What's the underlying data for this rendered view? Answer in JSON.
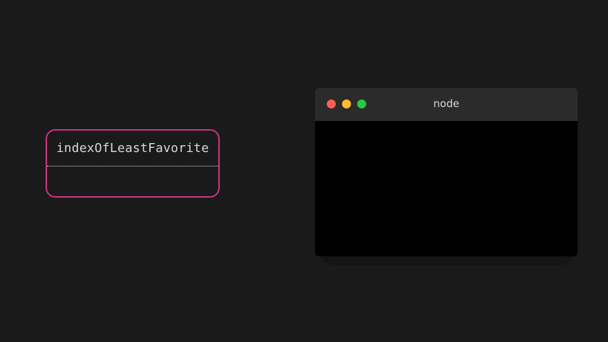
{
  "variable": {
    "name": "indexOfLeastFavorite",
    "value": ""
  },
  "terminal": {
    "title": "node",
    "output": "",
    "controls": {
      "close_color": "#ff5f57",
      "minimize_color": "#febc2e",
      "zoom_color": "#28c840"
    }
  },
  "colors": {
    "background": "#1a1a1a",
    "variable_border": "#d63384",
    "titlebar": "#2b2b2b",
    "terminal_body": "#000000"
  }
}
